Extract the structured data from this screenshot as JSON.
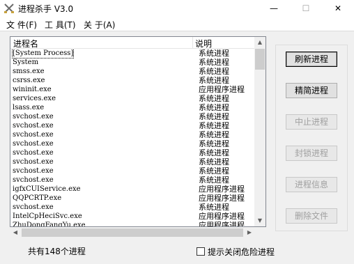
{
  "window": {
    "title": "进程杀手 V3.0",
    "controls": {
      "minimize": "—",
      "maximize": "☐",
      "close": "✕"
    }
  },
  "menu": [
    {
      "label": "文 件(F)"
    },
    {
      "label": "工 具(T)"
    },
    {
      "label": "关 于(A)"
    }
  ],
  "list": {
    "headers": {
      "name": "进程名",
      "desc": "说明"
    },
    "rows": [
      {
        "name": "[System Process]",
        "desc": "系统进程"
      },
      {
        "name": "System",
        "desc": "系统进程"
      },
      {
        "name": "smss.exe",
        "desc": "系统进程"
      },
      {
        "name": "csrss.exe",
        "desc": "系统进程"
      },
      {
        "name": "wininit.exe",
        "desc": "应用程序进程"
      },
      {
        "name": "services.exe",
        "desc": "系统进程"
      },
      {
        "name": "lsass.exe",
        "desc": "系统进程"
      },
      {
        "name": "svchost.exe",
        "desc": "系统进程"
      },
      {
        "name": "svchost.exe",
        "desc": "系统进程"
      },
      {
        "name": "svchost.exe",
        "desc": "系统进程"
      },
      {
        "name": "svchost.exe",
        "desc": "系统进程"
      },
      {
        "name": "svchost.exe",
        "desc": "系统进程"
      },
      {
        "name": "svchost.exe",
        "desc": "系统进程"
      },
      {
        "name": "svchost.exe",
        "desc": "系统进程"
      },
      {
        "name": "svchost.exe",
        "desc": "系统进程"
      },
      {
        "name": "igfxCUIService.exe",
        "desc": "应用程序进程"
      },
      {
        "name": "QQPCRTP.exe",
        "desc": "应用程序进程"
      },
      {
        "name": "svchost.exe",
        "desc": "系统进程"
      },
      {
        "name": "IntelCpHeciSvc.exe",
        "desc": "应用程序进程"
      },
      {
        "name": "ZhuDongFangYu.exe",
        "desc": "应用程序进程"
      }
    ]
  },
  "buttons": {
    "refresh": "刷新进程",
    "simplify": "精简进程",
    "terminate": "中止进程",
    "lock": "封锁进程",
    "info": "进程信息",
    "delete": "删除文件"
  },
  "status": {
    "count_text": "共有148个进程",
    "checkbox_label": "提示关闭危险进程",
    "checkbox_checked": false
  }
}
